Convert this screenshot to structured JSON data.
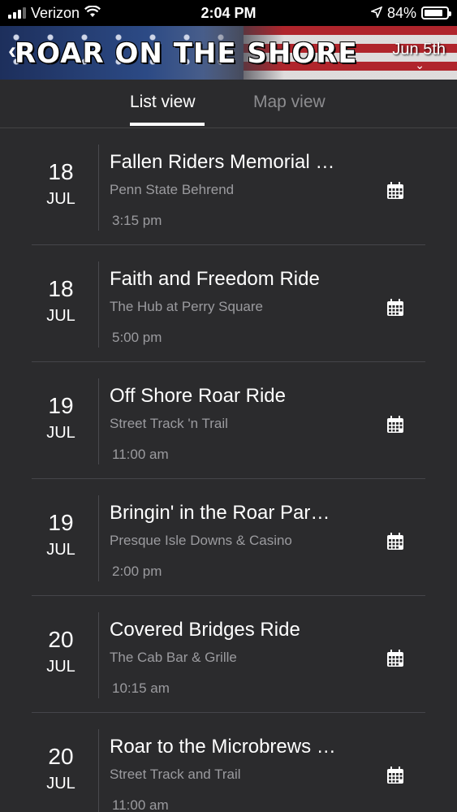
{
  "status": {
    "carrier": "Verizon",
    "time": "2:04 PM",
    "battery": "84%"
  },
  "header": {
    "title": "ROAR ON THE SHORE",
    "date": "Jun 5th"
  },
  "tabs": {
    "list_label": "List view",
    "map_label": "Map view"
  },
  "events": [
    {
      "day": "18",
      "month": "JUL",
      "title": "Fallen Riders Memorial …",
      "venue": "Penn State Behrend",
      "time": "3:15 pm"
    },
    {
      "day": "18",
      "month": "JUL",
      "title": "Faith and Freedom Ride",
      "venue": "The Hub at Perry Square",
      "time": "5:00 pm"
    },
    {
      "day": "19",
      "month": "JUL",
      "title": "Off Shore Roar Ride",
      "venue": "Street Track 'n Trail",
      "time": "11:00 am"
    },
    {
      "day": "19",
      "month": "JUL",
      "title": "Bringin' in the Roar Par…",
      "venue": "Presque Isle Downs & Casino",
      "time": "2:00 pm"
    },
    {
      "day": "20",
      "month": "JUL",
      "title": "Covered Bridges Ride",
      "venue": "The Cab Bar & Grille",
      "time": "10:15 am"
    },
    {
      "day": "20",
      "month": "JUL",
      "title": "Roar to the Microbrews …",
      "venue": "Street Track and Trail",
      "time": "11:00 am"
    }
  ]
}
